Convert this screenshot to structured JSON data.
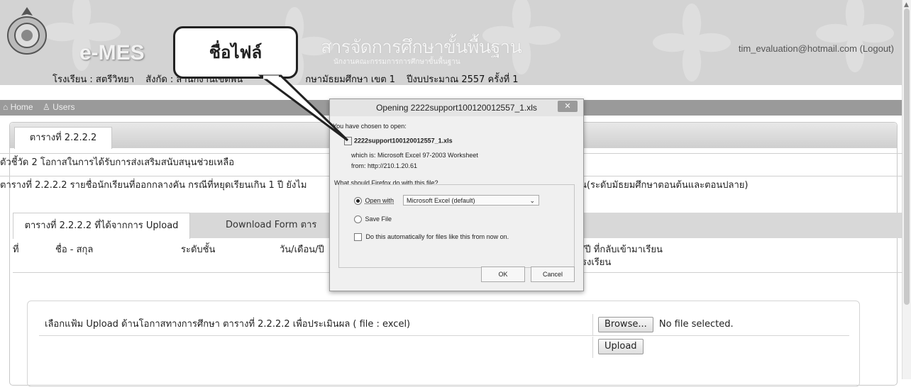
{
  "header": {
    "brand": "e-MES",
    "site_title": "สารจัดการศึกษาขั้นพื้นฐาน",
    "site_subtitle": "นักงานคณะกรรมการการศึกษาขั้นพื้นฐาน",
    "school_label": "โรงเรียน : สตรีวิทยา",
    "affiliation_label": "สังกัด : สำนักงานเขตพื้น",
    "affiliation_rest": "กษามัธยมศึกษา เขต 1",
    "fiscal_year": "ปีงบประมาณ 2557 ครั้งที่ 1",
    "user_email": "tim_evaluation@hotmail.com",
    "logout_label": "(Logout)"
  },
  "nav": {
    "home": "Home",
    "users": "Users"
  },
  "panel": {
    "tab_label": "ตารางที่ 2.2.2.2",
    "indicator_text": "ตัวชี้วัด 2 โอกาสในการได้รับการส่งเสริมสนับสนุนช่วยเหลือ",
    "table_desc_left": "ตารางที่ 2.2.2.2 รายชื่อนักเรียนที่ออกกลางคัน กรณีที่หยุดเรียนเกิน 1 ปี ยังไม",
    "table_desc_right": "น(ระดับมัธยมศึกษาตอนต้นและตอนปลาย)",
    "subtab_upload": "ตารางที่ 2.2.2.2 ที่ได้จากการ Upload",
    "subtab_download": "Download Form ตาร",
    "columns": {
      "no": "ที่",
      "name": "ชื่อ - สกุล",
      "level": "ระดับชั้น",
      "date": "วัน/เดือน/ปี",
      "return_line1": "/ปี ที่กลับเข้ามาเรียน",
      "return_line2": "รงเรียน"
    }
  },
  "upload": {
    "label": "เลือกแฟ้ม Upload ด้านโอกาสทางการศึกษา ตารางที่ 2.2.2.2 เพื่อประเมินผล ( file : excel)",
    "browse_button": "Browse...",
    "file_status": "No file selected.",
    "upload_button": "Upload"
  },
  "dialog": {
    "title": "Opening 2222support100120012557_1.xls",
    "close": "✕",
    "intro": "You have chosen to open:",
    "filename": "2222support100120012557_1.xls",
    "which_is": "which is: Microsoft Excel 97-2003 Worksheet",
    "from": "from: http://210.1.20.61",
    "question": "What should Firefox do with this file?",
    "open_with_label": "Open with",
    "open_with_app": "Microsoft Excel (default)",
    "save_file_label": "Save File",
    "auto_label": "Do this automatically for files like this from now on.",
    "ok_button": "OK",
    "cancel_button": "Cancel"
  },
  "callout": {
    "text": "ชื่อไฟล์"
  }
}
